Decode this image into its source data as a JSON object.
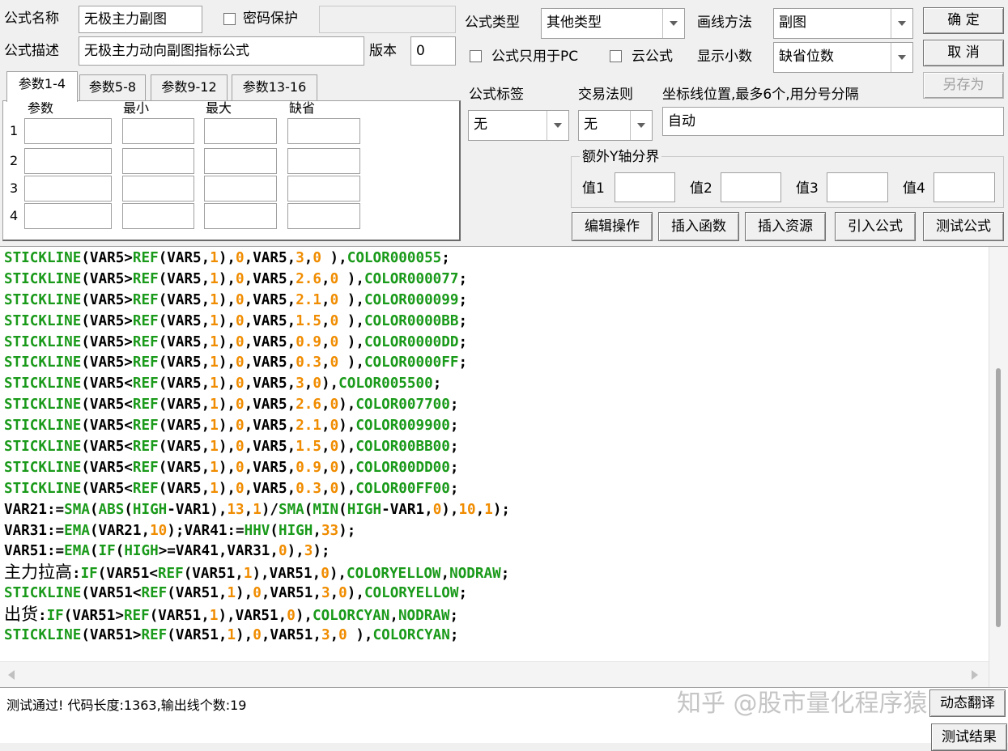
{
  "formula": {
    "name_label": "公式名称",
    "name_value": "无极主力副图",
    "password_label": "密码保护",
    "desc_label": "公式描述",
    "desc_value": "无极主力动向副图指标公式",
    "version_label": "版本",
    "version_value": "0"
  },
  "settings": {
    "type_label": "公式类型",
    "type_value": "其他类型",
    "draw_label": "画线方法",
    "draw_value": "副图",
    "pc_only_label": "公式只用于PC",
    "cloud_label": "云公式",
    "decimals_label": "显示小数",
    "decimals_value": "缺省位数",
    "tag_label": "公式标签",
    "tag_value": "无",
    "trade_label": "交易法则",
    "trade_value": "无",
    "axis_label": "坐标线位置,最多6个,用分号分隔",
    "axis_value": "自动",
    "yaxis_group_label": "额外Y轴分界",
    "y1_label": "值1",
    "y2_label": "值2",
    "y3_label": "值3",
    "y4_label": "值4"
  },
  "buttons": {
    "ok": "确  定",
    "cancel": "取  消",
    "save_as": "另存为",
    "edit_ops": "编辑操作",
    "insert_func": "插入函数",
    "insert_res": "插入资源",
    "import_formula": "引入公式",
    "test_formula": "测试公式",
    "translate": "动态翻译",
    "test_result": "测试结果"
  },
  "params": {
    "tabs": [
      "参数1-4",
      "参数5-8",
      "参数9-12",
      "参数13-16"
    ],
    "headers": [
      "参数",
      "最小",
      "最大",
      "缺省"
    ],
    "rows": [
      "1",
      "2",
      "3",
      "4"
    ]
  },
  "code_colors": {
    "function": "#1a9a1a",
    "number": "#f08c00",
    "text": "#000000"
  },
  "code": [
    [
      [
        "f",
        "STICKLINE"
      ],
      [
        "t",
        "(VAR5>"
      ],
      [
        "f",
        "REF"
      ],
      [
        "t",
        "(VAR5,"
      ],
      [
        "n",
        "1"
      ],
      [
        "t",
        "),"
      ],
      [
        "n",
        "0"
      ],
      [
        "t",
        ",VAR5,"
      ],
      [
        "n",
        "3"
      ],
      [
        "t",
        ","
      ],
      [
        "n",
        "0"
      ],
      [
        "t",
        " ),"
      ],
      [
        "f",
        "COLOR000055"
      ],
      [
        "t",
        ";"
      ]
    ],
    [
      [
        "f",
        "STICKLINE"
      ],
      [
        "t",
        "(VAR5>"
      ],
      [
        "f",
        "REF"
      ],
      [
        "t",
        "(VAR5,"
      ],
      [
        "n",
        "1"
      ],
      [
        "t",
        "),"
      ],
      [
        "n",
        "0"
      ],
      [
        "t",
        ",VAR5,"
      ],
      [
        "n",
        "2.6"
      ],
      [
        "t",
        ","
      ],
      [
        "n",
        "0"
      ],
      [
        "t",
        " ),"
      ],
      [
        "f",
        "COLOR000077"
      ],
      [
        "t",
        ";"
      ]
    ],
    [
      [
        "f",
        "STICKLINE"
      ],
      [
        "t",
        "(VAR5>"
      ],
      [
        "f",
        "REF"
      ],
      [
        "t",
        "(VAR5,"
      ],
      [
        "n",
        "1"
      ],
      [
        "t",
        "),"
      ],
      [
        "n",
        "0"
      ],
      [
        "t",
        ",VAR5,"
      ],
      [
        "n",
        "2.1"
      ],
      [
        "t",
        ","
      ],
      [
        "n",
        "0"
      ],
      [
        "t",
        " ),"
      ],
      [
        "f",
        "COLOR000099"
      ],
      [
        "t",
        ";"
      ]
    ],
    [
      [
        "f",
        "STICKLINE"
      ],
      [
        "t",
        "(VAR5>"
      ],
      [
        "f",
        "REF"
      ],
      [
        "t",
        "(VAR5,"
      ],
      [
        "n",
        "1"
      ],
      [
        "t",
        "),"
      ],
      [
        "n",
        "0"
      ],
      [
        "t",
        ",VAR5,"
      ],
      [
        "n",
        "1.5"
      ],
      [
        "t",
        ","
      ],
      [
        "n",
        "0"
      ],
      [
        "t",
        " ),"
      ],
      [
        "f",
        "COLOR0000BB"
      ],
      [
        "t",
        ";"
      ]
    ],
    [
      [
        "f",
        "STICKLINE"
      ],
      [
        "t",
        "(VAR5>"
      ],
      [
        "f",
        "REF"
      ],
      [
        "t",
        "(VAR5,"
      ],
      [
        "n",
        "1"
      ],
      [
        "t",
        "),"
      ],
      [
        "n",
        "0"
      ],
      [
        "t",
        ",VAR5,"
      ],
      [
        "n",
        "0.9"
      ],
      [
        "t",
        ","
      ],
      [
        "n",
        "0"
      ],
      [
        "t",
        " ),"
      ],
      [
        "f",
        "COLOR0000DD"
      ],
      [
        "t",
        ";"
      ]
    ],
    [
      [
        "f",
        "STICKLINE"
      ],
      [
        "t",
        "(VAR5>"
      ],
      [
        "f",
        "REF"
      ],
      [
        "t",
        "(VAR5,"
      ],
      [
        "n",
        "1"
      ],
      [
        "t",
        "),"
      ],
      [
        "n",
        "0"
      ],
      [
        "t",
        ",VAR5,"
      ],
      [
        "n",
        "0.3"
      ],
      [
        "t",
        ","
      ],
      [
        "n",
        "0"
      ],
      [
        "t",
        " ),"
      ],
      [
        "f",
        "COLOR0000FF"
      ],
      [
        "t",
        ";"
      ]
    ],
    [
      [
        "f",
        "STICKLINE"
      ],
      [
        "t",
        "(VAR5<"
      ],
      [
        "f",
        "REF"
      ],
      [
        "t",
        "(VAR5,"
      ],
      [
        "n",
        "1"
      ],
      [
        "t",
        "),"
      ],
      [
        "n",
        "0"
      ],
      [
        "t",
        ",VAR5,"
      ],
      [
        "n",
        "3"
      ],
      [
        "t",
        ","
      ],
      [
        "n",
        "0"
      ],
      [
        "t",
        "),"
      ],
      [
        "f",
        "COLOR005500"
      ],
      [
        "t",
        ";"
      ]
    ],
    [
      [
        "f",
        "STICKLINE"
      ],
      [
        "t",
        "(VAR5<"
      ],
      [
        "f",
        "REF"
      ],
      [
        "t",
        "(VAR5,"
      ],
      [
        "n",
        "1"
      ],
      [
        "t",
        "),"
      ],
      [
        "n",
        "0"
      ],
      [
        "t",
        ",VAR5,"
      ],
      [
        "n",
        "2.6"
      ],
      [
        "t",
        ","
      ],
      [
        "n",
        "0"
      ],
      [
        "t",
        "),"
      ],
      [
        "f",
        "COLOR007700"
      ],
      [
        "t",
        ";"
      ]
    ],
    [
      [
        "f",
        "STICKLINE"
      ],
      [
        "t",
        "(VAR5<"
      ],
      [
        "f",
        "REF"
      ],
      [
        "t",
        "(VAR5,"
      ],
      [
        "n",
        "1"
      ],
      [
        "t",
        "),"
      ],
      [
        "n",
        "0"
      ],
      [
        "t",
        ",VAR5,"
      ],
      [
        "n",
        "2.1"
      ],
      [
        "t",
        ","
      ],
      [
        "n",
        "0"
      ],
      [
        "t",
        "),"
      ],
      [
        "f",
        "COLOR009900"
      ],
      [
        "t",
        ";"
      ]
    ],
    [
      [
        "f",
        "STICKLINE"
      ],
      [
        "t",
        "(VAR5<"
      ],
      [
        "f",
        "REF"
      ],
      [
        "t",
        "(VAR5,"
      ],
      [
        "n",
        "1"
      ],
      [
        "t",
        "),"
      ],
      [
        "n",
        "0"
      ],
      [
        "t",
        ",VAR5,"
      ],
      [
        "n",
        "1.5"
      ],
      [
        "t",
        ","
      ],
      [
        "n",
        "0"
      ],
      [
        "t",
        "),"
      ],
      [
        "f",
        "COLOR00BB00"
      ],
      [
        "t",
        ";"
      ]
    ],
    [
      [
        "f",
        "STICKLINE"
      ],
      [
        "t",
        "(VAR5<"
      ],
      [
        "f",
        "REF"
      ],
      [
        "t",
        "(VAR5,"
      ],
      [
        "n",
        "1"
      ],
      [
        "t",
        "),"
      ],
      [
        "n",
        "0"
      ],
      [
        "t",
        ",VAR5,"
      ],
      [
        "n",
        "0.9"
      ],
      [
        "t",
        ","
      ],
      [
        "n",
        "0"
      ],
      [
        "t",
        "),"
      ],
      [
        "f",
        "COLOR00DD00"
      ],
      [
        "t",
        ";"
      ]
    ],
    [
      [
        "f",
        "STICKLINE"
      ],
      [
        "t",
        "(VAR5<"
      ],
      [
        "f",
        "REF"
      ],
      [
        "t",
        "(VAR5,"
      ],
      [
        "n",
        "1"
      ],
      [
        "t",
        "),"
      ],
      [
        "n",
        "0"
      ],
      [
        "t",
        ",VAR5,"
      ],
      [
        "n",
        "0.3"
      ],
      [
        "t",
        ","
      ],
      [
        "n",
        "0"
      ],
      [
        "t",
        "),"
      ],
      [
        "f",
        "COLOR00FF00"
      ],
      [
        "t",
        ";"
      ]
    ],
    [
      [
        "t",
        "VAR21:="
      ],
      [
        "f",
        "SMA"
      ],
      [
        "t",
        "("
      ],
      [
        "f",
        "ABS"
      ],
      [
        "t",
        "("
      ],
      [
        "f",
        "HIGH"
      ],
      [
        "t",
        "-VAR1),"
      ],
      [
        "n",
        "13"
      ],
      [
        "t",
        ","
      ],
      [
        "n",
        "1"
      ],
      [
        "t",
        ")/"
      ],
      [
        "f",
        "SMA"
      ],
      [
        "t",
        "("
      ],
      [
        "f",
        "MIN"
      ],
      [
        "t",
        "("
      ],
      [
        "f",
        "HIGH"
      ],
      [
        "t",
        "-VAR1,"
      ],
      [
        "n",
        "0"
      ],
      [
        "t",
        "),"
      ],
      [
        "n",
        "10"
      ],
      [
        "t",
        ","
      ],
      [
        "n",
        "1"
      ],
      [
        "t",
        ");"
      ]
    ],
    [
      [
        "t",
        "VAR31:="
      ],
      [
        "f",
        "EMA"
      ],
      [
        "t",
        "(VAR21,"
      ],
      [
        "n",
        "10"
      ],
      [
        "t",
        ");VAR41:="
      ],
      [
        "f",
        "HHV"
      ],
      [
        "t",
        "("
      ],
      [
        "f",
        "HIGH"
      ],
      [
        "t",
        ","
      ],
      [
        "n",
        "33"
      ],
      [
        "t",
        ");"
      ]
    ],
    [
      [
        "t",
        "VAR51:="
      ],
      [
        "f",
        "EMA"
      ],
      [
        "t",
        "("
      ],
      [
        "f",
        "IF"
      ],
      [
        "t",
        "("
      ],
      [
        "f",
        "HIGH"
      ],
      [
        "t",
        ">=VAR41,VAR31,"
      ],
      [
        "n",
        "0"
      ],
      [
        "t",
        "),"
      ],
      [
        "n",
        "3"
      ],
      [
        "t",
        ");"
      ]
    ],
    [
      [
        "c",
        "主力拉高"
      ],
      [
        "t",
        ":"
      ],
      [
        "f",
        "IF"
      ],
      [
        "t",
        "(VAR51<"
      ],
      [
        "f",
        "REF"
      ],
      [
        "t",
        "(VAR51,"
      ],
      [
        "n",
        "1"
      ],
      [
        "t",
        "),VAR51,"
      ],
      [
        "n",
        "0"
      ],
      [
        "t",
        "),"
      ],
      [
        "f",
        "COLORYELLOW"
      ],
      [
        "t",
        ","
      ],
      [
        "f",
        "NODRAW"
      ],
      [
        "t",
        ";"
      ]
    ],
    [
      [
        "f",
        "STICKLINE"
      ],
      [
        "t",
        "(VAR51<"
      ],
      [
        "f",
        "REF"
      ],
      [
        "t",
        "(VAR51,"
      ],
      [
        "n",
        "1"
      ],
      [
        "t",
        "),"
      ],
      [
        "n",
        "0"
      ],
      [
        "t",
        ",VAR51,"
      ],
      [
        "n",
        "3"
      ],
      [
        "t",
        ","
      ],
      [
        "n",
        "0"
      ],
      [
        "t",
        "),"
      ],
      [
        "f",
        "COLORYELLOW"
      ],
      [
        "t",
        ";"
      ]
    ],
    [
      [
        "c",
        "出货"
      ],
      [
        "t",
        ":"
      ],
      [
        "f",
        "IF"
      ],
      [
        "t",
        "(VAR51>"
      ],
      [
        "f",
        "REF"
      ],
      [
        "t",
        "(VAR51,"
      ],
      [
        "n",
        "1"
      ],
      [
        "t",
        "),VAR51,"
      ],
      [
        "n",
        "0"
      ],
      [
        "t",
        "),"
      ],
      [
        "f",
        "COLORCYAN"
      ],
      [
        "t",
        ","
      ],
      [
        "f",
        "NODRAW"
      ],
      [
        "t",
        ";"
      ]
    ],
    [
      [
        "f",
        "STICKLINE"
      ],
      [
        "t",
        "(VAR51>"
      ],
      [
        "f",
        "REF"
      ],
      [
        "t",
        "(VAR51,"
      ],
      [
        "n",
        "1"
      ],
      [
        "t",
        "),"
      ],
      [
        "n",
        "0"
      ],
      [
        "t",
        ",VAR51,"
      ],
      [
        "n",
        "3"
      ],
      [
        "t",
        ","
      ],
      [
        "n",
        "0"
      ],
      [
        "t",
        " ),"
      ],
      [
        "f",
        "COLORCYAN"
      ],
      [
        "t",
        ";"
      ]
    ]
  ],
  "status": {
    "message": "测试通过! 代码长度:1363,输出线个数:19"
  },
  "watermark": "知乎 @股市量化程序猿"
}
